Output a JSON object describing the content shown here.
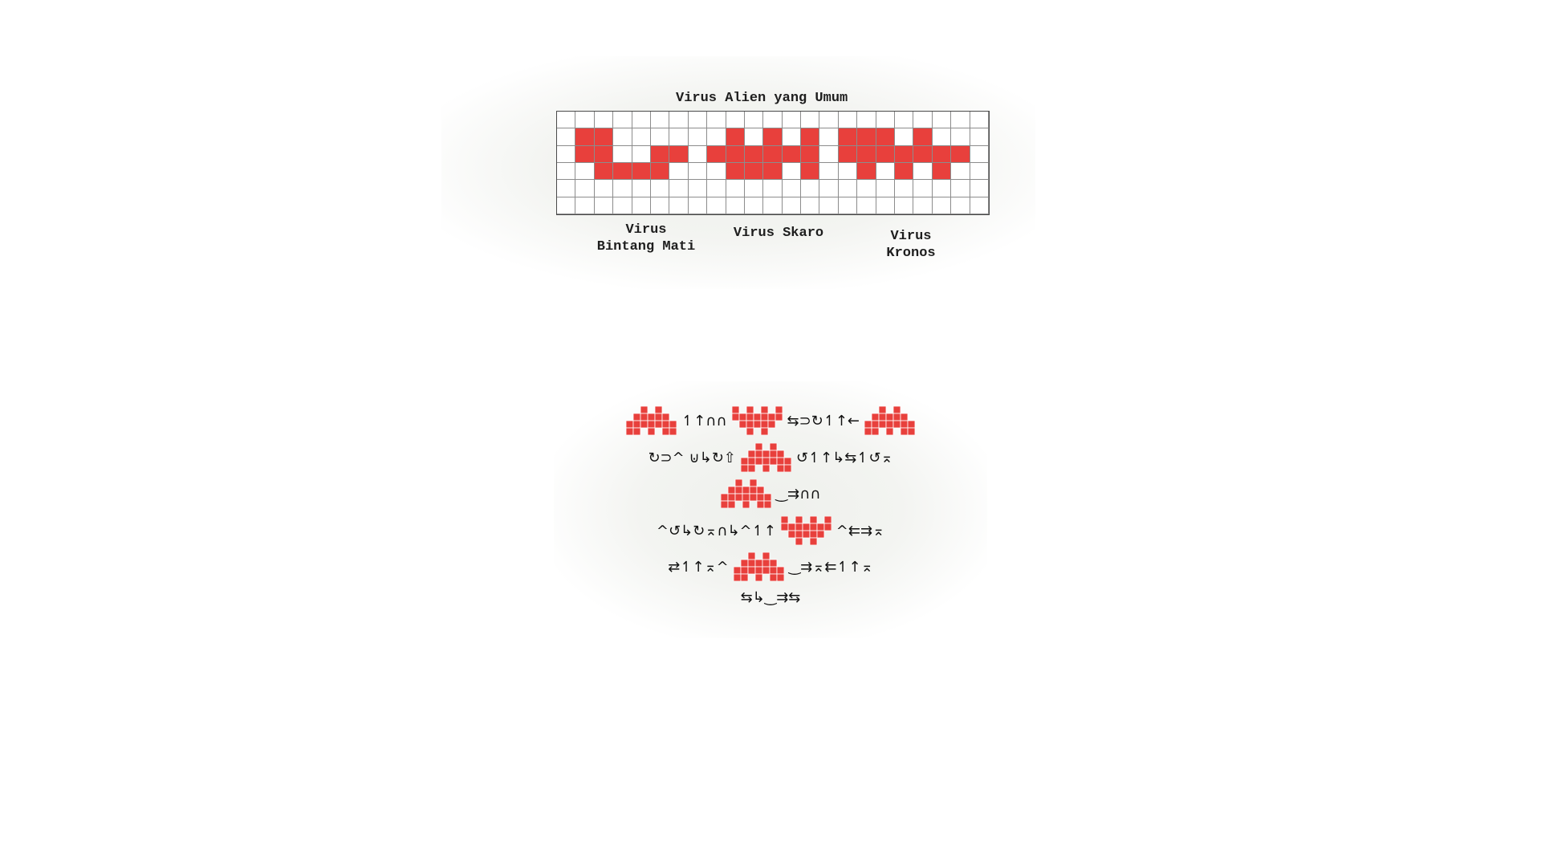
{
  "chart": {
    "title": "Virus Alien yang Umum",
    "labels": [
      {
        "line1": "Virus",
        "line2": "Bintang Mati"
      },
      {
        "line1": "Virus Skaro",
        "line2": ""
      },
      {
        "line1": "Virus",
        "line2": "Kronos"
      }
    ]
  },
  "message": {
    "lines": [
      {
        "parts": [
          {
            "virus": "kronos"
          },
          {
            "text": "↿↑∩∩"
          },
          {
            "virus": "skaro"
          },
          {
            "text": "⇆⊃↻↿↑←"
          },
          {
            "virus": "kronos"
          }
        ]
      },
      {
        "parts": [
          {
            "text": "↻⊃^  ⊍↳↻⇧"
          },
          {
            "virus": "kronos"
          },
          {
            "text": "↺↿↑↳⇆↿↺⌅"
          }
        ]
      },
      {
        "parts": [
          {
            "virus": "kronos"
          },
          {
            "text": "‿⇉∩∩"
          }
        ]
      },
      {
        "parts": [
          {
            "text": "^↺↳↻⌅∩↳^↿↑"
          },
          {
            "virus": "skaro"
          },
          {
            "text": "^⇇⇉⌅"
          }
        ]
      },
      {
        "parts": [
          {
            "text": "⇄↿↑⌅^"
          },
          {
            "virus": "kronos"
          },
          {
            "text": "‿⇉⌅⇇↿↑⌅"
          }
        ]
      },
      {
        "parts": [
          {
            "text": "⇆↳‿⇉⇆"
          }
        ]
      }
    ]
  },
  "colors": {
    "virus_red": "#e8403c",
    "grid_line": "#8c8c8c",
    "text": "#1e1e1e"
  }
}
